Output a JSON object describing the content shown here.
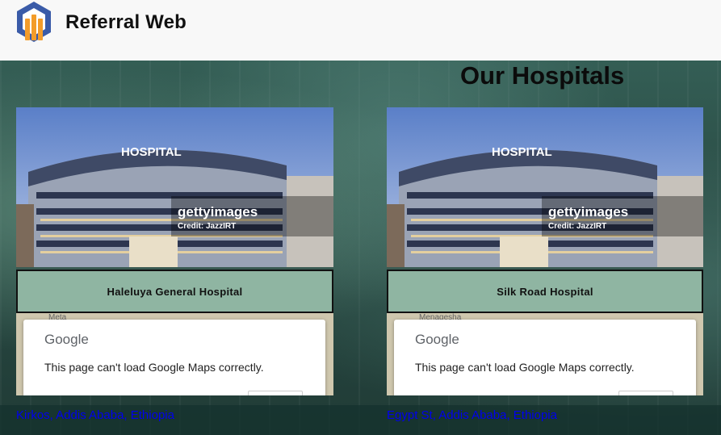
{
  "header": {
    "brand": "Referral Web"
  },
  "page_title": "Our Hospitals",
  "hospitals": [
    {
      "name": "Haleluya General Hospital",
      "image_sign": "HOSPITAL",
      "watermark": "gettyimages",
      "credit": "Credit: JazzIRT",
      "map": {
        "provider": "Google",
        "message": "This page can't load Google Maps correctly.",
        "street_label": "Meta"
      },
      "address": "Kirkos, Addis Ababa, Ethiopia"
    },
    {
      "name": "Silk Road Hospital",
      "image_sign": "HOSPITAL",
      "watermark": "gettyimages",
      "credit": "Credit: JazzIRT",
      "map": {
        "provider": "Google",
        "message": "This page can't load Google Maps correctly.",
        "street_label": "Menagesha"
      },
      "address": "Egypt St, Addis Ababa, Ethiopia"
    }
  ],
  "colors": {
    "header_bg": "#f8f8f8",
    "name_bar_bg": "#8fb5a2",
    "link": "#0000ee",
    "logo_blue": "#3a5ba8",
    "logo_orange": "#f39c2a"
  }
}
